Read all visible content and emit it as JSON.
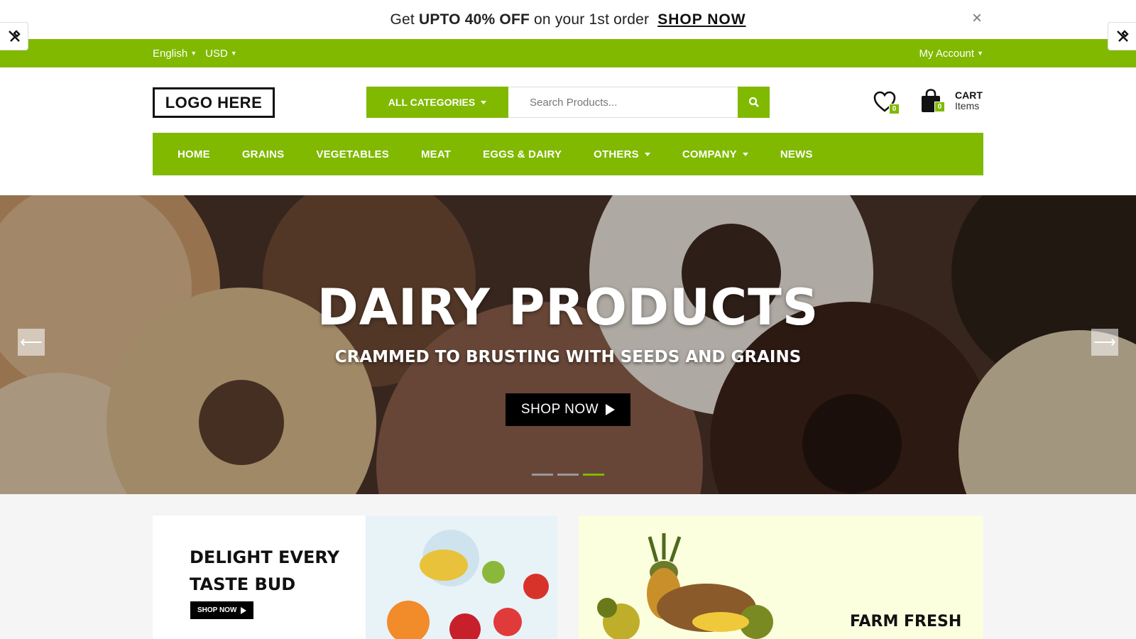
{
  "promo": {
    "text_prefix": "Get ",
    "text_highlight": "UPTO 40% OFF",
    "text_suffix": " on your 1st order",
    "link": "SHOP NOW",
    "close": "×"
  },
  "topbar": {
    "language": "English",
    "currency": "USD",
    "account": "My Account"
  },
  "header": {
    "logo": "LOGO HERE",
    "category_button": "ALL CATEGORIES",
    "search_placeholder": "Search Products...",
    "wishlist_count": "0",
    "cart_count": "0",
    "cart_label": "CART",
    "cart_sub": "Items"
  },
  "nav": {
    "items": [
      {
        "label": "HOME",
        "dropdown": false
      },
      {
        "label": "GRAINS",
        "dropdown": false
      },
      {
        "label": "VEGETABLES",
        "dropdown": false
      },
      {
        "label": "MEAT",
        "dropdown": false
      },
      {
        "label": "EGGS & DAIRY",
        "dropdown": false
      },
      {
        "label": "OTHERS",
        "dropdown": true
      },
      {
        "label": "COMPANY",
        "dropdown": true
      },
      {
        "label": "NEWS",
        "dropdown": false
      }
    ]
  },
  "hero": {
    "title": "DAIRY PRODUCTS",
    "subtitle": "CRAMMED TO BRUSTING WITH SEEDS AND GRAINS",
    "button": "SHOP NOW",
    "prev_arrow": "⟵",
    "next_arrow": "⟶",
    "slide_count": 3,
    "active_slide": 3
  },
  "banners": {
    "left_title_line1": "DELIGHT EVERY",
    "left_title_line2": "TASTE BUD",
    "left_button": "SHOP NOW",
    "right_title": "FARM FRESH"
  },
  "colors": {
    "accent": "#80b900",
    "dark": "#000000"
  }
}
